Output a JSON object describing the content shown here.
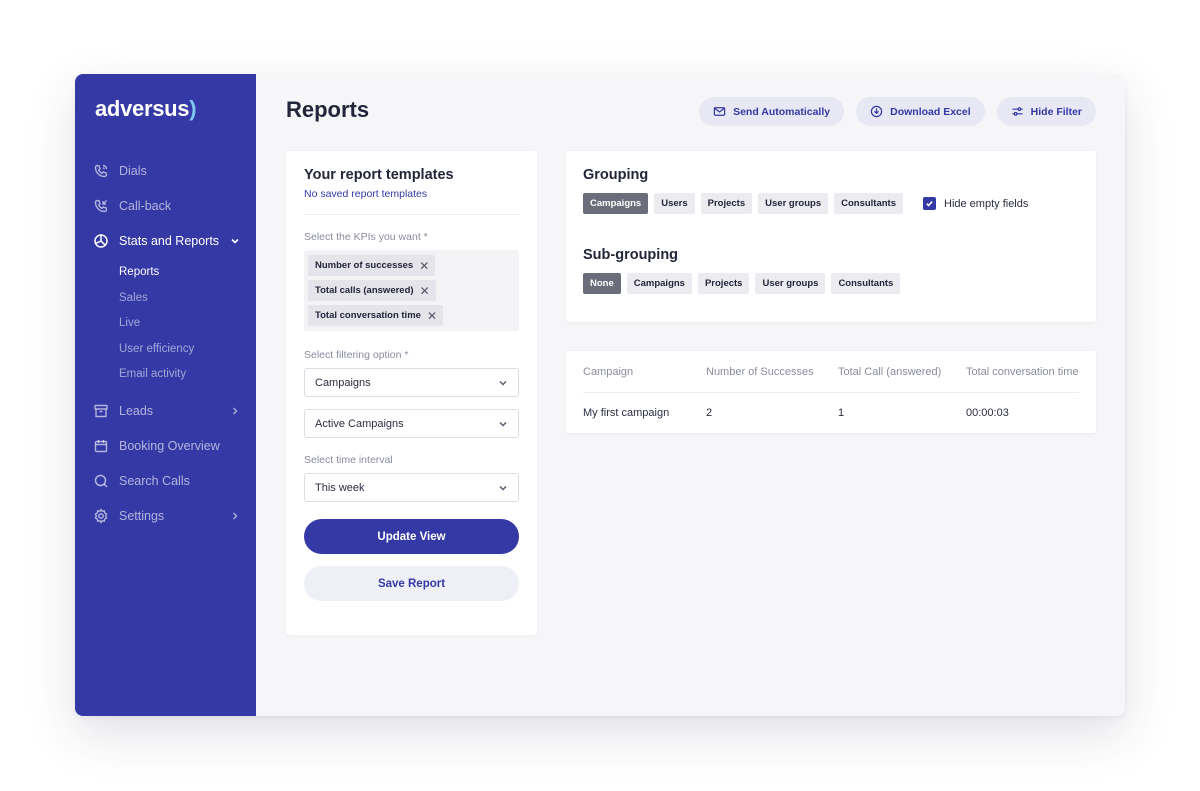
{
  "app": {
    "logo_text": "adversus",
    "logo_paren": ")"
  },
  "sidebar": {
    "items": [
      {
        "label": "Dials",
        "icon": "phone-icon"
      },
      {
        "label": "Call-back",
        "icon": "phone-callback-icon"
      },
      {
        "label": "Stats and Reports",
        "icon": "pie-chart-icon"
      },
      {
        "label": "Leads",
        "icon": "archive-icon"
      },
      {
        "label": "Booking Overview",
        "icon": "calendar-icon"
      },
      {
        "label": "Search Calls",
        "icon": "search-icon"
      },
      {
        "label": "Settings",
        "icon": "gear-icon"
      }
    ],
    "stats_subitems": [
      "Reports",
      "Sales",
      "Live",
      "User efficiency",
      "Email activity"
    ]
  },
  "header": {
    "title": "Reports",
    "actions": {
      "send": "Send Automatically",
      "download": "Download Excel",
      "hide_filter": "Hide Filter"
    }
  },
  "filters": {
    "title": "Your report templates",
    "subtitle": "No saved report templates",
    "kpi_label": "Select the KPIs you want *",
    "kpis": [
      "Number of successes",
      "Total calls (answered)",
      "Total conversation time"
    ],
    "filter_label": "Select filtering option *",
    "filter_value": "Campaigns",
    "filter_sub_value": "Active Campaigns",
    "time_label": "Select time interval",
    "time_value": "This week",
    "update_button": "Update View",
    "save_button": "Save Report"
  },
  "grouping": {
    "title": "Grouping",
    "options": [
      "Campaigns",
      "Users",
      "Projects",
      "User groups",
      "Consultants"
    ],
    "selected": "Campaigns",
    "hide_empty_label": "Hide empty fields",
    "hide_empty_checked": true
  },
  "subgrouping": {
    "title": "Sub-grouping",
    "options": [
      "None",
      "Campaigns",
      "Projects",
      "User groups",
      "Consultants"
    ],
    "selected": "None"
  },
  "table": {
    "headers": [
      "Campaign",
      "Number of Successes",
      "Total Call (answered)",
      "Total conversation time"
    ],
    "rows": [
      [
        "My first campaign",
        "2",
        "1",
        "00:00:03"
      ]
    ]
  },
  "colors": {
    "sidebar": "#3439a6",
    "accent": "#3439a6",
    "logo_paren": "#7ec8f2"
  }
}
